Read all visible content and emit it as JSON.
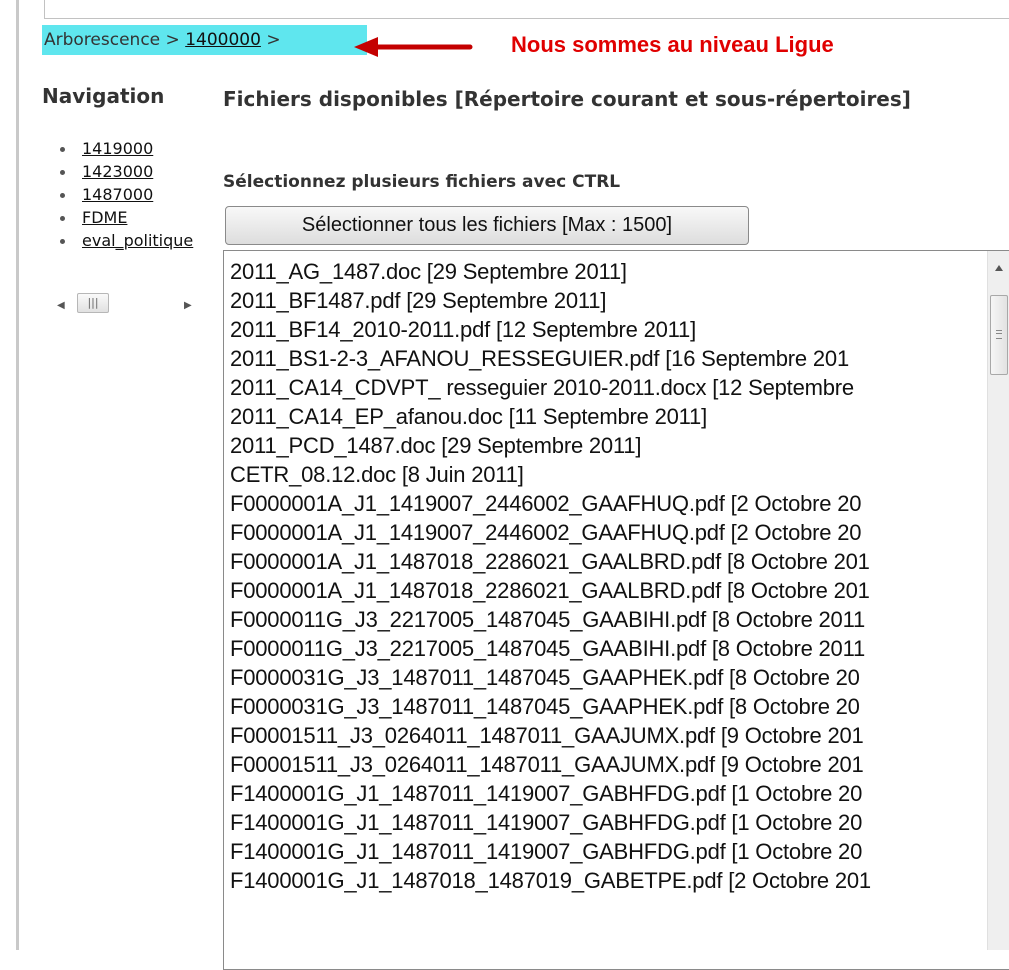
{
  "breadcrumb": {
    "root": "Arborescence",
    "separator1": ">",
    "current": "1400000",
    "separator2": ">"
  },
  "annotation": {
    "text": "Nous sommes au niveau Ligue",
    "color": "#e00000"
  },
  "navigation": {
    "title": "Navigation",
    "items": [
      "1419000",
      "1423000",
      "1487000",
      "FDME",
      "eval_politique"
    ]
  },
  "files": {
    "title": "Fichiers disponibles [Répertoire courant et sous-répertoires]",
    "hint": "Sélectionnez plusieurs fichiers avec CTRL",
    "select_all_label": "Sélectionner tous les fichiers [Max : 1500]",
    "items": [
      "2011_AG_1487.doc [29 Septembre 2011]",
      "2011_BF1487.pdf [29 Septembre 2011]",
      "2011_BF14_2010-2011.pdf [12 Septembre 2011]",
      "2011_BS1-2-3_AFANOU_RESSEGUIER.pdf [16 Septembre 201",
      "2011_CA14_CDVPT_ resseguier 2010-2011.docx [12 Septembre",
      "2011_CA14_EP_afanou.doc [11 Septembre 2011]",
      "2011_PCD_1487.doc [29 Septembre 2011]",
      "CETR_08.12.doc [8 Juin 2011]",
      "F0000001A_J1_1419007_2446002_GAAFHUQ.pdf [2 Octobre 20",
      "F0000001A_J1_1419007_2446002_GAAFHUQ.pdf [2 Octobre 20",
      "F0000001A_J1_1487018_2286021_GAALBRD.pdf [8 Octobre 201",
      "F0000001A_J1_1487018_2286021_GAALBRD.pdf [8 Octobre 201",
      "F0000011G_J3_2217005_1487045_GAABIHI.pdf [8 Octobre 2011",
      "F0000011G_J3_2217005_1487045_GAABIHI.pdf [8 Octobre 2011",
      "F0000031G_J3_1487011_1487045_GAAPHEK.pdf [8 Octobre 20",
      "F0000031G_J3_1487011_1487045_GAAPHEK.pdf [8 Octobre 20",
      "F00001511_J3_0264011_1487011_GAAJUMX.pdf [9 Octobre 201",
      "F00001511_J3_0264011_1487011_GAAJUMX.pdf [9 Octobre 201",
      "F1400001G_J1_1487011_1419007_GABHFDG.pdf [1 Octobre 20",
      "F1400001G_J1_1487011_1419007_GABHFDG.pdf [1 Octobre 20",
      "F1400001G_J1_1487011_1419007_GABHFDG.pdf [1 Octobre 20",
      "F1400001G_J1_1487018_1487019_GABETPE.pdf [2 Octobre 201"
    ]
  },
  "colors": {
    "breadcrumb_highlight": "#5fe6ee",
    "arrow": "#c40000"
  },
  "icons": {
    "arrow": "left-arrow-icon",
    "scroll_left": "scroll-left-icon",
    "scroll_right": "scroll-right-icon",
    "scroll_up": "scroll-up-icon"
  }
}
